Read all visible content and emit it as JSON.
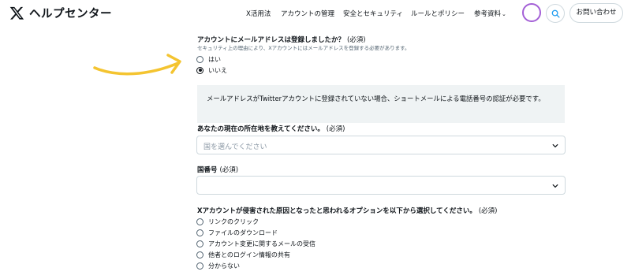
{
  "header": {
    "logo_text": "ヘルプセンター",
    "nav": [
      {
        "label": "X活用法"
      },
      {
        "label": "アカウントの管理"
      },
      {
        "label": "安全とセキュリティ"
      },
      {
        "label": "ルールとポリシー"
      },
      {
        "label": "参考資料",
        "chevron": "⌄"
      }
    ],
    "contact_label": "お問い合わせ"
  },
  "q1": {
    "title": "アカウントにメールアドレスは登録しましたか？",
    "required": "(必須)",
    "subtitle": "セキュリティ上の理由により、Xアカウントにはメールアドレスを登録する必要があります。",
    "options": [
      {
        "label": "はい",
        "selected": false
      },
      {
        "label": "いいえ",
        "selected": true
      }
    ]
  },
  "info": {
    "text": "メールアドレスがTwitterアカウントに登録されていない場合、ショートメールによる電話番号の認証が必要です。"
  },
  "q2": {
    "title": "あなたの現在の所在地を教えてください。",
    "required": "(必須)",
    "placeholder": "国を選んでください"
  },
  "q3": {
    "title": "国番号",
    "required": "(必須)",
    "value": ""
  },
  "q4": {
    "title": "Xアカウントが侵害された原因となったと思われるオプションを以下から選択してください。",
    "required": "(必須)",
    "options": [
      {
        "label": "リンクのクリック"
      },
      {
        "label": "ファイルのダウンロード"
      },
      {
        "label": "アカウント変更に関するメールの受信"
      },
      {
        "label": "他者とのログイン情報の共有"
      },
      {
        "label": "分からない"
      }
    ]
  },
  "colors": {
    "annotation_arrow": "#f4c430",
    "avatar_ring": "#a35fd6",
    "info_bg": "#eff3f4"
  }
}
